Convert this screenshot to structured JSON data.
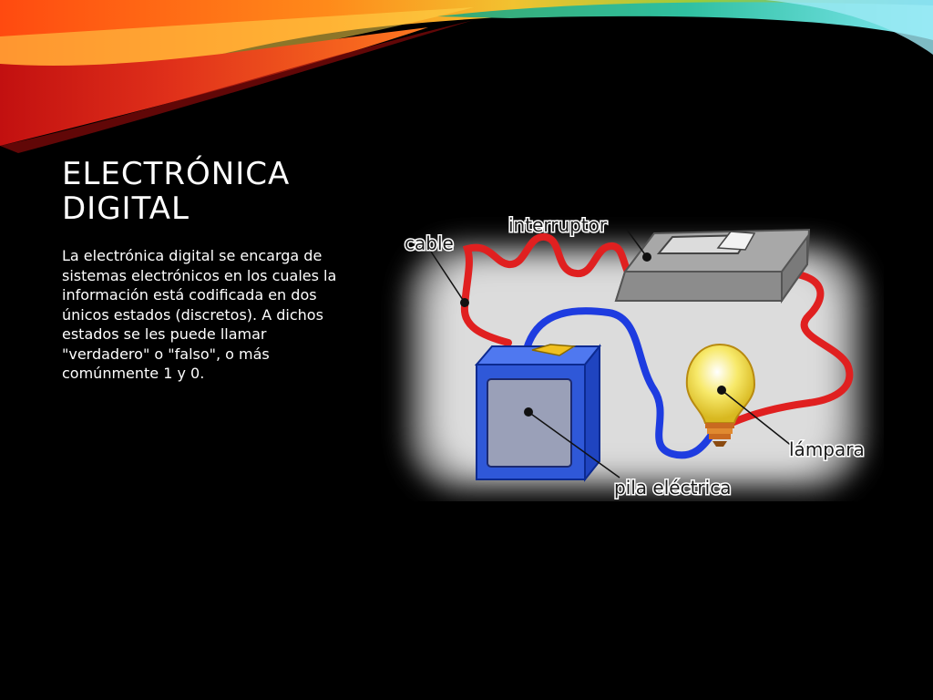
{
  "slide": {
    "title_line1": "ELECTRÓNICA",
    "title_line2": "DIGITAL",
    "body": "La electrónica digital se encarga de sistemas electrónicos en los cuales la información está codificada en dos únicos estados (discretos). A dichos estados se les puede llamar \"verdadero\" o \"falso\", o más comúnmente 1 y 0."
  },
  "diagram": {
    "labels": {
      "cable": "cable",
      "interruptor": "interruptor",
      "lampara": "lámpara",
      "pila": "pila eléctrica"
    },
    "colors": {
      "wire_red": "#e02020",
      "wire_blue": "#1e3ce0",
      "battery": "#2f58d8",
      "battery_terminal": "#f0c020",
      "switch": "#a8a8a8",
      "bulb": "#f5e36a"
    }
  },
  "theme": {
    "background": "#000000",
    "text": "#ffffff"
  }
}
